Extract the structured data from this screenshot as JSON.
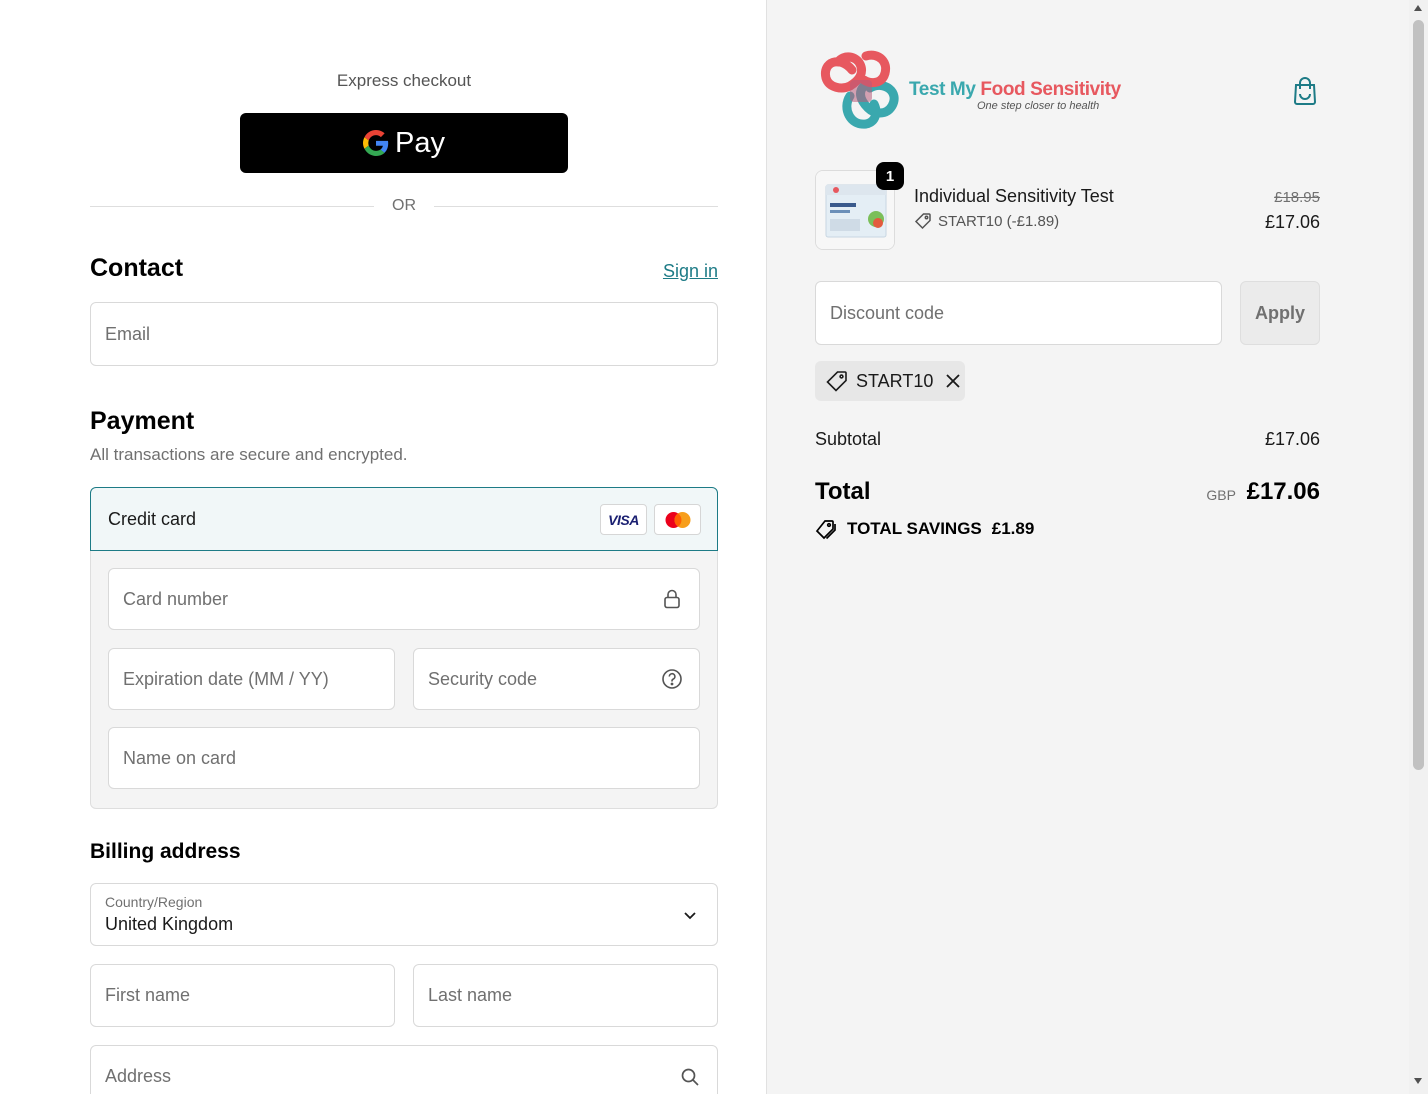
{
  "express": {
    "label": "Express checkout",
    "gpay_label": "Pay"
  },
  "divider_text": "OR",
  "contact": {
    "heading": "Contact",
    "sign_in": "Sign in",
    "email_placeholder": "Email"
  },
  "payment": {
    "heading": "Payment",
    "subtitle": "All transactions are secure and encrypted.",
    "method_label": "Credit card",
    "visa_label": "VISA",
    "card_number_placeholder": "Card number",
    "expiry_placeholder": "Expiration date (MM / YY)",
    "security_placeholder": "Security code",
    "name_placeholder": "Name on card"
  },
  "billing": {
    "heading": "Billing address",
    "country_label": "Country/Region",
    "country_value": "United Kingdom",
    "first_name_placeholder": "First name",
    "last_name_placeholder": "Last name",
    "address_placeholder": "Address"
  },
  "brand": {
    "name_part1": "Test My ",
    "name_part2": "Food Sensitivity",
    "tagline": "One step closer to health",
    "colors": {
      "teal": "#3aa8ae",
      "coral": "#e7585f",
      "accent": "#1d7b86"
    }
  },
  "cart": {
    "quantity": "1",
    "product_name": "Individual Sensitivity Test",
    "product_discount": "START10 (-£1.89)",
    "original_price": "£18.95",
    "price": "£17.06",
    "discount_placeholder": "Discount code",
    "apply_label": "Apply",
    "applied_code": "START10"
  },
  "summary": {
    "subtotal_label": "Subtotal",
    "subtotal_value": "£17.06",
    "total_label": "Total",
    "currency": "GBP",
    "total_value": "£17.06",
    "savings_label": "TOTAL SAVINGS",
    "savings_value": "£1.89"
  }
}
